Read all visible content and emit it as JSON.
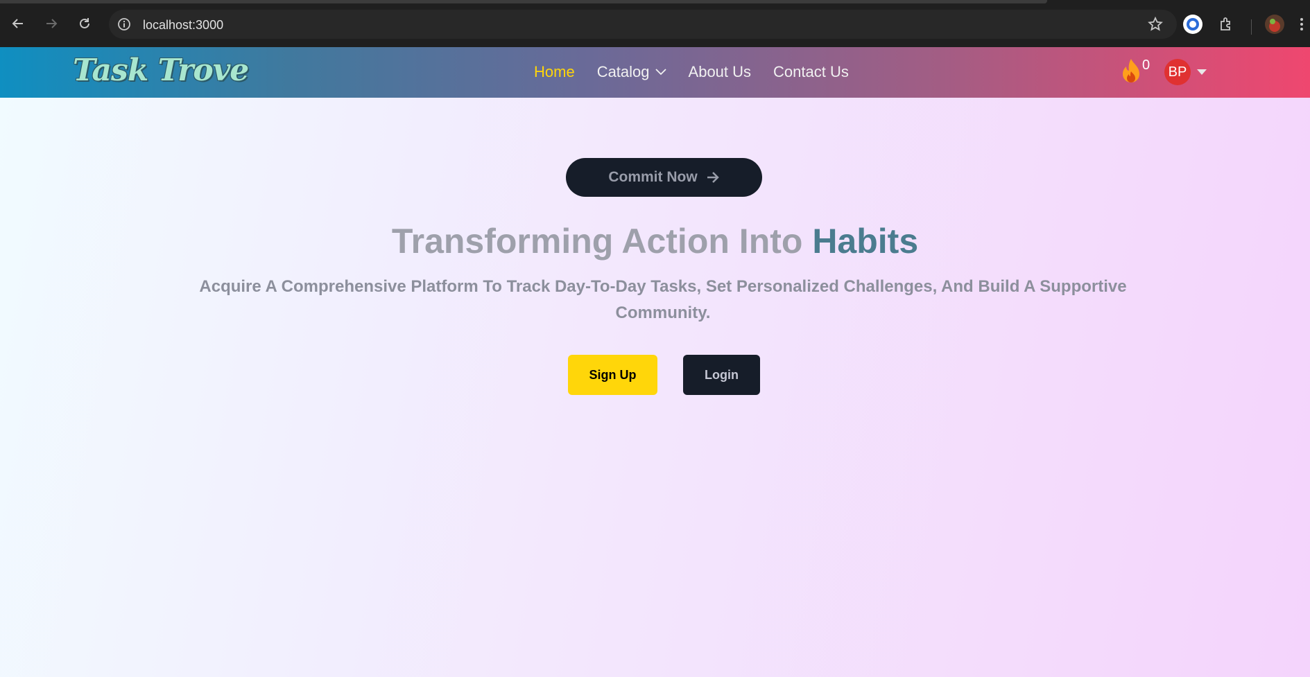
{
  "browser": {
    "url": "localhost:3000"
  },
  "site": {
    "logo_text": "Task Trove",
    "nav": {
      "home": "Home",
      "catalog": "Catalog",
      "about": "About Us",
      "contact": "Contact Us"
    },
    "streak_count": "0",
    "avatar_initials": "BP"
  },
  "hero": {
    "commit_button": "Commit Now",
    "headline_part1": "Transforming Action Into ",
    "headline_accent": "Habits",
    "subtitle": "Acquire A Comprehensive Platform To Track Day-To-Day Tasks, Set Personalized Challenges, And Build A Supportive Community.",
    "signup_button": "Sign Up",
    "login_button": "Login"
  },
  "colors": {
    "accent_yellow": "#ffd60a",
    "dark_button": "#161d29",
    "avatar_red": "#e03131",
    "headline_accent": "#4b7c8f"
  },
  "icons": [
    "back-icon",
    "forward-icon",
    "reload-icon",
    "info-icon",
    "bookmark-star-icon",
    "password-manager-icon",
    "extensions-icon",
    "profile-avatar-icon",
    "more-menu-icon",
    "chevron-down-icon",
    "flame-icon",
    "caret-down-icon",
    "arrow-right-icon"
  ]
}
